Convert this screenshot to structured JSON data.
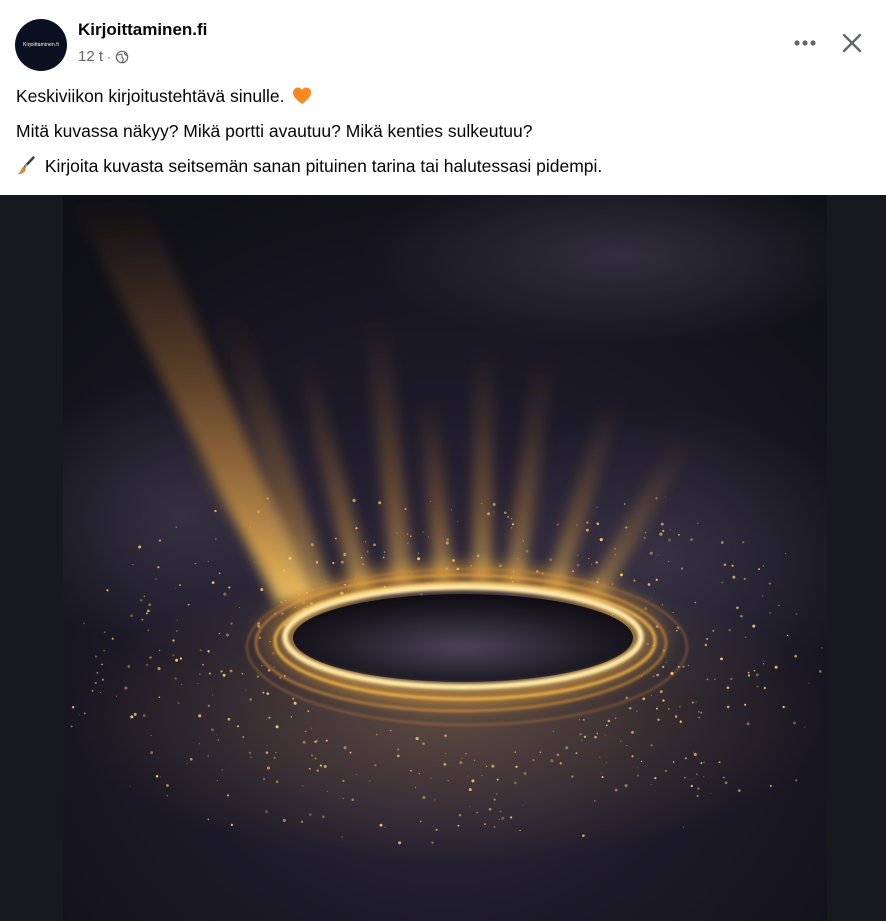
{
  "post": {
    "page_name": "Kirjoittaminen.fi",
    "avatar_text": "Kirjoittaminen.fi",
    "time": "12 t",
    "separator": "·",
    "audience_icon": "globe-icon",
    "more_icon": "more-horizontal-icon",
    "close_icon": "close-icon",
    "lines": {
      "line1": "Keskiviikon kirjoitustehtävä sinulle.",
      "line2": "Mitä kuvassa näkyy? Mikä portti avautuu? Mikä kenties sulkeutuu?",
      "line3": "Kirjoita kuvasta seitsemän sanan pituinen tarina tai halutessasi pidempi."
    },
    "emoji": {
      "heart": "orange-heart-icon",
      "pen": "paintbrush-icon"
    },
    "image": {
      "subject": "glowing golden ring portal in dark space",
      "colors": {
        "background": "#18181f",
        "glow": "#ffb43a",
        "ring": "#ffd76a"
      }
    }
  }
}
